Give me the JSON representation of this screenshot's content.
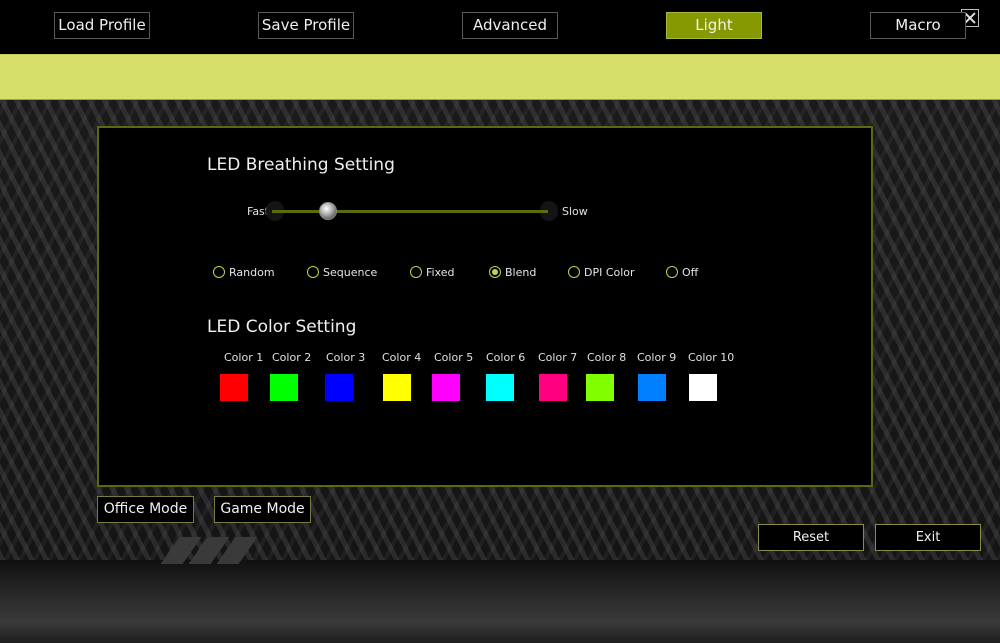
{
  "nav": {
    "load_profile": "Load Profile",
    "save_profile": "Save Profile",
    "advanced": "Advanced",
    "light": "Light",
    "macro": "Macro"
  },
  "breathing": {
    "title": "LED Breathing Setting",
    "fast_label": "Fast",
    "slow_label": "Slow",
    "speed_fraction": 0.18
  },
  "modes": {
    "selected": "Blend",
    "options": [
      "Random",
      "Sequence",
      "Fixed",
      "Blend",
      "DPI Color",
      "Off"
    ]
  },
  "colors": {
    "title": "LED Color Setting",
    "items": [
      {
        "label": "Color 1",
        "hex": "#ff0000"
      },
      {
        "label": "Color 2",
        "hex": "#00ff00"
      },
      {
        "label": "Color 3",
        "hex": "#0000ff"
      },
      {
        "label": "Color 4",
        "hex": "#ffff00"
      },
      {
        "label": "Color 5",
        "hex": "#ff00ff"
      },
      {
        "label": "Color 6",
        "hex": "#00ffff"
      },
      {
        "label": "Color 7",
        "hex": "#ff0080"
      },
      {
        "label": "Color 8",
        "hex": "#80ff00"
      },
      {
        "label": "Color 9",
        "hex": "#0080ff"
      },
      {
        "label": "Color 10",
        "hex": "#ffffff"
      }
    ]
  },
  "mode_buttons": {
    "office": "Office Mode",
    "game": "Game Mode"
  },
  "footer": {
    "reset": "Reset",
    "exit": "Exit"
  },
  "theme": {
    "accent": "#d6df6a",
    "active_tab": "#869900"
  }
}
